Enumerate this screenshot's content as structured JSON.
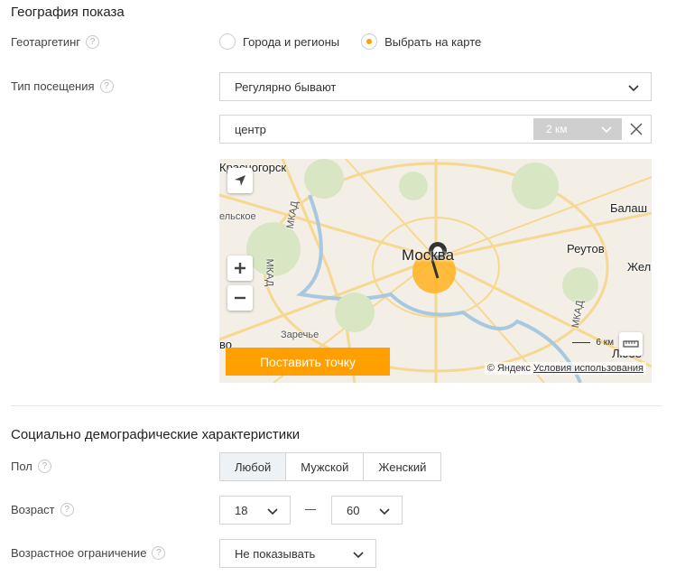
{
  "geo": {
    "title": "География показа",
    "targeting_label": "Геотаргетинг",
    "radio_cities": "Города и регионы",
    "radio_map": "Выбрать на карте",
    "visit_type_label": "Тип посещения",
    "visit_type_value": "Регулярно бывают",
    "search_value": "центр",
    "radius_value": "2 км",
    "map": {
      "labels": [
        "Красногорск",
        "ельское",
        "МКАД",
        "Москва",
        "Реутов",
        "Балаш",
        "Жел",
        "Заречье",
        "во",
        "Любе"
      ],
      "scale": "6 км",
      "place_button": "Поставить точку",
      "copyright": "© Яндекс",
      "terms": "Условия использования",
      "accent_color": "#ff9f00"
    }
  },
  "social": {
    "title": "Социально демографические характеристики",
    "gender_label": "Пол",
    "gender_options": [
      "Любой",
      "Мужской",
      "Женский"
    ],
    "gender_selected": "Любой",
    "age_label": "Возраст",
    "age_from": "18",
    "age_to": "60",
    "age_limit_label": "Возрастное ограничение",
    "age_limit_value": "Не показывать"
  },
  "help_glyph": "?"
}
